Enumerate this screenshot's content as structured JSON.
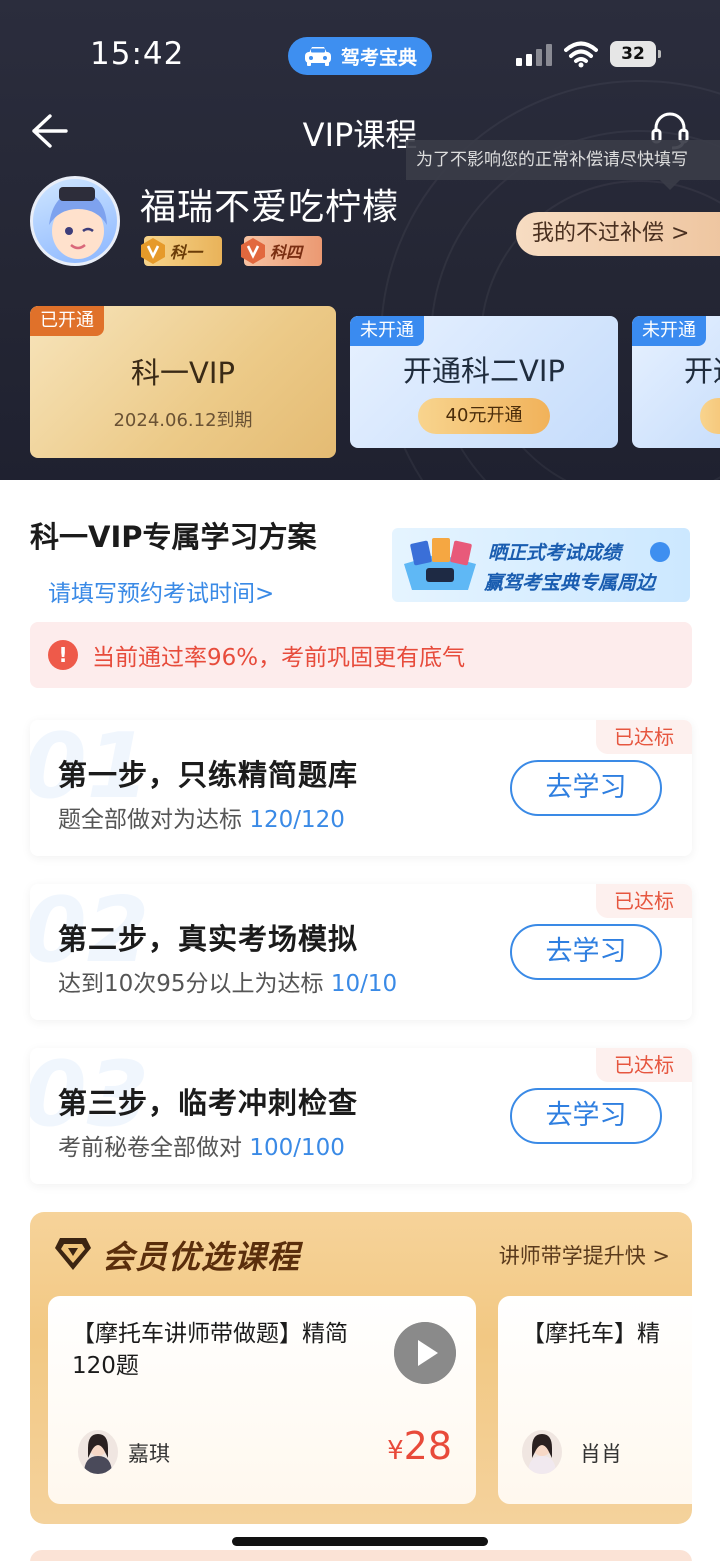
{
  "status_bar": {
    "time": "15:42",
    "app_pill": "驾考宝典",
    "battery": "32"
  },
  "nav": {
    "title": "VIP课程"
  },
  "tooltip": "为了不影响您的正常补偿请尽快填写",
  "user": {
    "name": "福瑞不爱吃柠檬",
    "badges": [
      "科一",
      "科四"
    ],
    "compensation_button": "我的不过补偿 >"
  },
  "vip_cards": [
    {
      "tag": "已开通",
      "title": "科一VIP",
      "subtitle": "2024.06.12到期"
    },
    {
      "tag": "未开通",
      "title": "开通科二VIP",
      "button": "40元开通"
    },
    {
      "tag": "未开通",
      "title": "开通"
    }
  ],
  "plan": {
    "title": "科一VIP专属学习方案",
    "link": "请填写预约考试时间>",
    "banner": {
      "line1": "晒正式考试成绩",
      "line2": "赢驾考宝典专属周边"
    },
    "alert": "当前通过率96%，考前巩固更有底气"
  },
  "steps": [
    {
      "ghost": "01",
      "title": "第一步，只练精简题库",
      "desc": "题全部做对为达标",
      "progress": "120/120",
      "badge": "已达标",
      "button": "去学习"
    },
    {
      "ghost": "02",
      "title": "第二步，真实考场模拟",
      "desc": "达到10次95分以上为达标",
      "progress": "10/10",
      "badge": "已达标",
      "button": "去学习"
    },
    {
      "ghost": "03",
      "title": "第三步，临考冲刺检查",
      "desc": "考前秘卷全部做对",
      "progress": "100/100",
      "badge": "已达标",
      "button": "去学习"
    }
  ],
  "courses": {
    "title": "会员优选课程",
    "more": "讲师带学提升快 >",
    "items": [
      {
        "title": "【摩托车讲师带做题】精简120题",
        "teacher": "嘉琪",
        "currency": "¥",
        "price": "28"
      },
      {
        "title": "【摩托车】精",
        "teacher": "肖肖"
      }
    ]
  },
  "colors": {
    "accent_blue": "#3a8ae6",
    "alert_red": "#e74c3c",
    "gold": "#ecca88"
  }
}
